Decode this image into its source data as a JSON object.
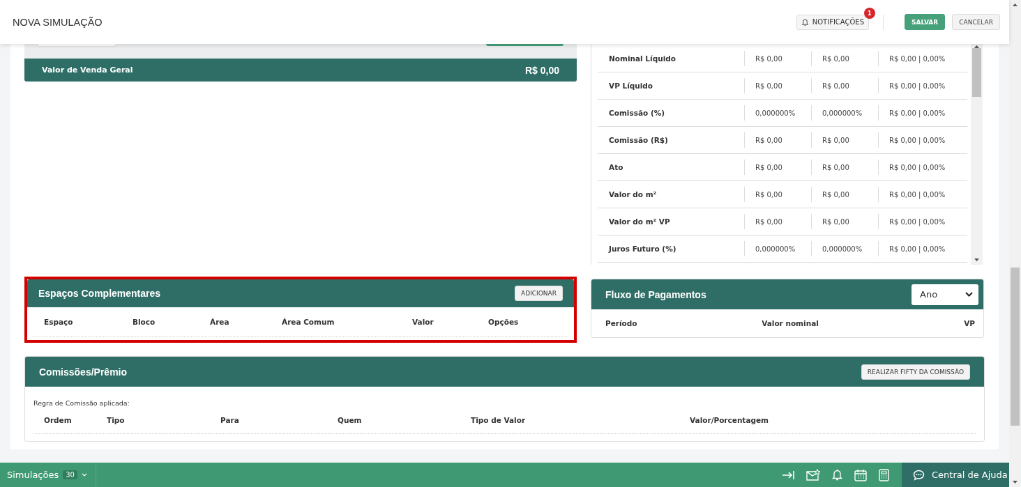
{
  "header": {
    "title": "NOVA SIMULAÇÃO",
    "notifications": {
      "label": "NOTIFICAÇÕES",
      "count": "1"
    },
    "buttons": [
      {
        "label": "SALVAR",
        "kind": "primary"
      },
      {
        "label": "CANCELAR",
        "kind": "secondary"
      }
    ]
  },
  "sale_total": {
    "label": "Valor de Venda Geral",
    "value": "R$ 0,00"
  },
  "summary_table": {
    "rows": [
      {
        "label": "Nominal Líquido",
        "cells": [
          "R$ 0,00",
          "R$ 0,00",
          "R$ 0,00 | 0,00%"
        ]
      },
      {
        "label": "VP Líquido",
        "cells": [
          "R$ 0,00",
          "R$ 0,00",
          "R$ 0,00 | 0,00%"
        ]
      },
      {
        "label": "Comissão (%)",
        "cells": [
          "0,000000%",
          "0,000000%",
          "R$ 0,00 | 0,00%"
        ]
      },
      {
        "label": "Comissão (R$)",
        "cells": [
          "R$ 0,00",
          "R$ 0,00",
          "R$ 0,00 | 0,00%"
        ]
      },
      {
        "label": "Ato",
        "cells": [
          "R$ 0,00",
          "R$ 0,00",
          "R$ 0,00 | 0,00%"
        ]
      },
      {
        "label": "Valor do m²",
        "cells": [
          "R$ 0,00",
          "R$ 0,00",
          "R$ 0,00 | 0,00%"
        ]
      },
      {
        "label": "Valor do m² VP",
        "cells": [
          "R$ 0,00",
          "R$ 0,00",
          "R$ 0,00 | 0,00%"
        ]
      },
      {
        "label": "Juros Futuro (%)",
        "cells": [
          "0,000000%",
          "0,000000%",
          "R$ 0,00 | 0,00%"
        ]
      }
    ]
  },
  "espacos": {
    "title": "Espaços Complementares",
    "highlighted": true,
    "button": "ADICIONAR",
    "columns": [
      "Espaço",
      "Bloco",
      "Área",
      "Área Comum",
      "Valor",
      "Opções"
    ]
  },
  "fluxo": {
    "title": "Fluxo de Pagamentos",
    "select": {
      "value": "Ano"
    },
    "columns": [
      "Período",
      "Valor nominal",
      "VP"
    ]
  },
  "comissoes": {
    "title": "Comissões/Prêmio",
    "button": "REALIZAR FIFTY DA COMISSÃO",
    "rule_label": "Regra de Comissão aplicada:",
    "columns": [
      "Ordem",
      "Tipo",
      "Para",
      "Quem",
      "Tipo de Valor",
      "Valor/Porcentagem"
    ]
  },
  "bottom_bar": {
    "simulations": {
      "label": "Simulações",
      "count": "30"
    },
    "help": "Central de Ajuda"
  }
}
